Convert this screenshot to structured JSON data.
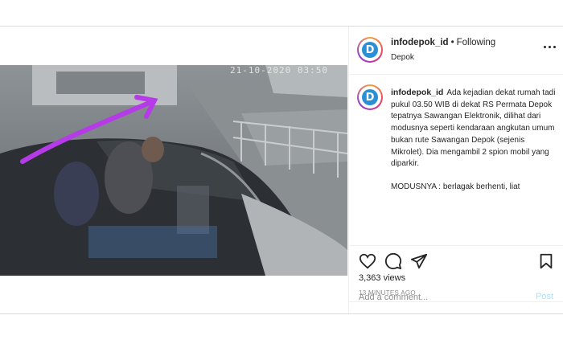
{
  "header": {
    "username": "infodepok_id",
    "separator": "•",
    "follow_status": "Following",
    "location": "Depok",
    "avatar_letter": "D"
  },
  "video": {
    "timestamp_overlay": "21-10-2020 03:50",
    "mute_icon": "speaker-muted-icon",
    "annotation_color": "#b63ae8"
  },
  "caption": {
    "username": "infodepok_id",
    "text": "Ada kejadian dekat rumah tadi pukul 03.50 WIB di dekat RS Permata Depok tepatnya Sawangan Elektronik, dilihat dari modusnya seperti kendaraan angkutan umum bukan rute Sawangan Depok (sejenis Mikrolet). Dia mengambil 2 spion mobil yang diparkir.",
    "extra": "MODUSNYA : berlagak berhenti, liat"
  },
  "actions": {
    "like_icon": "heart-icon",
    "comment_icon": "comment-bubble-icon",
    "share_icon": "paper-plane-icon",
    "save_icon": "bookmark-icon"
  },
  "stats": {
    "views": "3,363 views",
    "time_ago": "13 MINUTES AGO"
  },
  "comment": {
    "placeholder": "Add a comment...",
    "post_label": "Post"
  },
  "colors": {
    "border": "#dbdbdb",
    "muted_text": "#8e8e8e",
    "post_button_disabled": "#b2dffc",
    "brand_logo": "#2b8fd6"
  }
}
